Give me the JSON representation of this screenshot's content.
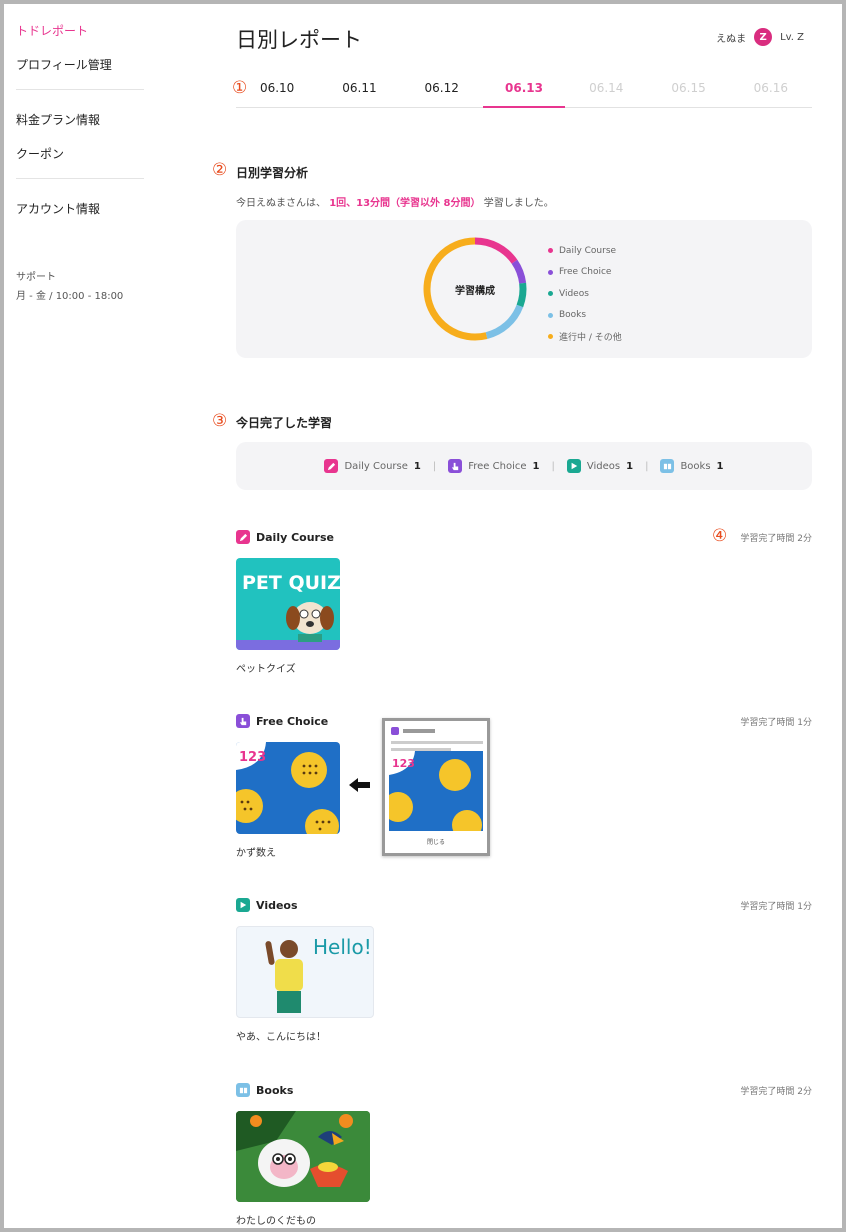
{
  "sidebar": {
    "active_item": "トドレポート",
    "items": [
      "プロフィール管理",
      "料金プラン情報",
      "クーポン",
      "アカウント情報"
    ],
    "support_label": "サポート",
    "support_hours": "月 - 金 / 10:00 - 18:00"
  },
  "header": {
    "title": "日別レポート",
    "user_name": "えぬま",
    "level_badge": "Z",
    "level_text": "Lv. Z"
  },
  "markers": [
    "①",
    "②",
    "③",
    "④"
  ],
  "tabs": [
    "06.10",
    "06.11",
    "06.12",
    "06.13",
    "06.14",
    "06.15",
    "06.16"
  ],
  "active_tab": "06.13",
  "analysis": {
    "title": "日別学習分析",
    "summary_prefix": "今日えぬまさんは、",
    "summary_highlight": "1回、13分間（学習以外 8分間）",
    "summary_suffix": "学習しました。",
    "donut_center": "学習構成",
    "chart_data": {
      "type": "pie",
      "categories": [
        "Daily Course",
        "Free Choice",
        "Videos",
        "Books",
        "進行中 / その他"
      ],
      "values": [
        2,
        1,
        1,
        2,
        7
      ],
      "colors": [
        "#e8358f",
        "#8a4fd8",
        "#1aa892",
        "#7cc0e6",
        "#f7ad1c"
      ]
    }
  },
  "completed": {
    "title": "今日完了した学習",
    "counts": [
      {
        "label": "Daily Course",
        "value": "1",
        "color": "#e8358f",
        "icon": "pencil-icon"
      },
      {
        "label": "Free Choice",
        "value": "1",
        "color": "#8a4fd8",
        "icon": "hand-icon"
      },
      {
        "label": "Videos",
        "value": "1",
        "color": "#1aa892",
        "icon": "play-icon"
      },
      {
        "label": "Books",
        "value": "1",
        "color": "#7cc0e6",
        "icon": "book-icon"
      }
    ]
  },
  "blocks": [
    {
      "name": "Daily Course",
      "time": "学習完了時間 2分",
      "caption": "ペットクイズ",
      "thumb_text": "PET QUIZ"
    },
    {
      "name": "Free Choice",
      "time": "学習完了時間 1分",
      "caption": "かず数え",
      "thumb_text": "123"
    },
    {
      "name": "Videos",
      "time": "学習完了時間 1分",
      "caption": "やあ、こんにちは！",
      "thumb_text": "Hello!"
    },
    {
      "name": "Books",
      "time": "学習完了時間 2分",
      "caption": "わたしのくだもの"
    }
  ],
  "popup": {
    "button": "閉じる"
  }
}
